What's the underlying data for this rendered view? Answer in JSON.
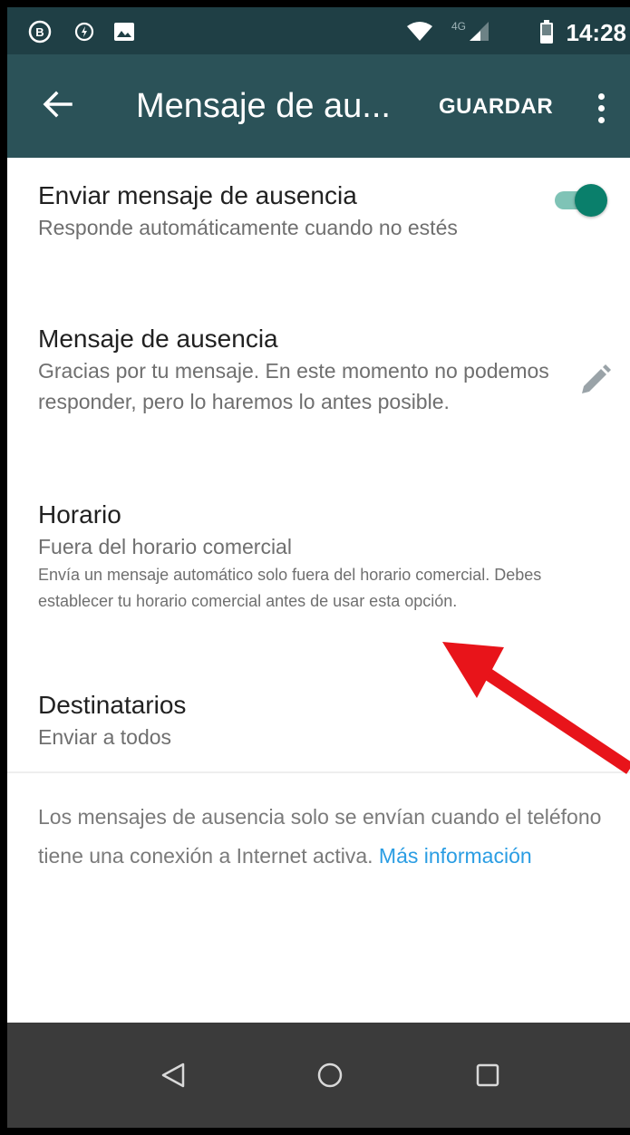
{
  "status_bar": {
    "time": "14:28",
    "network": "4G",
    "left_icons": [
      "b-circle-icon",
      "data-saver-icon",
      "image-icon"
    ],
    "right_icons": [
      "wifi-icon",
      "signal-icon",
      "battery-icon"
    ]
  },
  "app_bar": {
    "title": "Mensaje de au...",
    "save_label": "GUARDAR",
    "back_icon": "arrow-left-icon",
    "more_icon": "more-vert-icon"
  },
  "settings": {
    "away_toggle": {
      "title": "Enviar mensaje de ausencia",
      "subtitle": "Responde automáticamente cuando no estés",
      "enabled": true
    },
    "away_message": {
      "title": "Mensaje de ausencia",
      "subtitle": "Gracias por tu mensaje. En este momento no podemos responder, pero lo haremos lo antes posible."
    },
    "schedule": {
      "title": "Horario",
      "subtitle": "Fuera del horario comercial",
      "note": "Envía un mensaje automático solo fuera del horario comercial. Debes establecer tu horario comercial antes de usar esta opción."
    },
    "recipients": {
      "title": "Destinatarios",
      "subtitle": "Enviar a todos"
    }
  },
  "footer": {
    "note": "Los mensajes de ausencia solo se envían cuando el teléfono tiene una conexión a Internet activa.",
    "link": "Más información"
  },
  "colors": {
    "status_bar": "#1f3f45",
    "app_bar": "#2b5258",
    "toggle_thumb": "#0a7f6b",
    "toggle_track": "#7fc3b6",
    "link": "#2a9de3",
    "annotation_arrow": "#e8141a",
    "nav_bar": "#3b3b3b"
  },
  "nav_bar": {
    "icons": [
      "nav-back-icon",
      "nav-home-icon",
      "nav-recents-icon"
    ]
  }
}
